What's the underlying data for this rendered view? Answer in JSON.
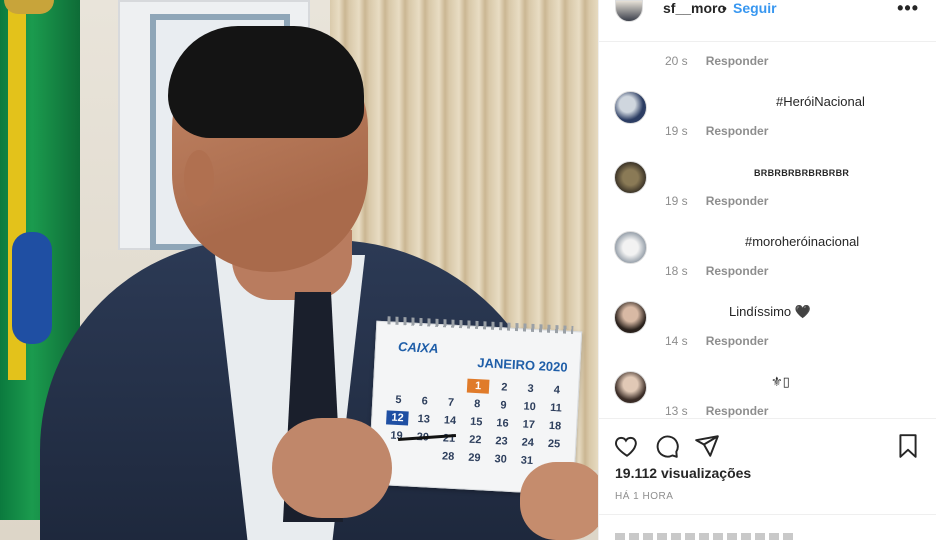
{
  "post": {
    "username": "sf__moro",
    "separator": "•",
    "follow_label": "Seguir",
    "more_label": "•••"
  },
  "media": {
    "calendar": {
      "brand": "CAIXA",
      "month": "JANEIRO 2020",
      "days": [
        "",
        "",
        "",
        "1",
        "2",
        "3",
        "4",
        "5",
        "6",
        "7",
        "8",
        "9",
        "10",
        "11",
        "12",
        "13",
        "14",
        "15",
        "16",
        "17",
        "18",
        "19",
        "20",
        "21",
        "22",
        "23",
        "24",
        "25",
        "",
        "",
        "28",
        "29",
        "30",
        "31",
        "",
        ""
      ]
    }
  },
  "comments": [
    {
      "text": "",
      "time": "20 s",
      "reply": "Responder"
    },
    {
      "text": "#HeróiNacional",
      "time": "19 s",
      "reply": "Responder"
    },
    {
      "text": "BRBRBRBRBRBRBR",
      "time": "19 s",
      "reply": "Responder"
    },
    {
      "text": "#moroheróinacional",
      "time": "18 s",
      "reply": "Responder"
    },
    {
      "text": "Lindíssimo 🖤",
      "time": "14 s",
      "reply": "Responder"
    },
    {
      "text": "⚜▯",
      "time": "13 s",
      "reply": "Responder"
    }
  ],
  "actions": {
    "views": "19.112 visualizações",
    "time_ago": "HÁ 1 HORA"
  },
  "colors": {
    "accent": "#3897f0",
    "text": "#262626",
    "muted": "#8e8e8e"
  }
}
